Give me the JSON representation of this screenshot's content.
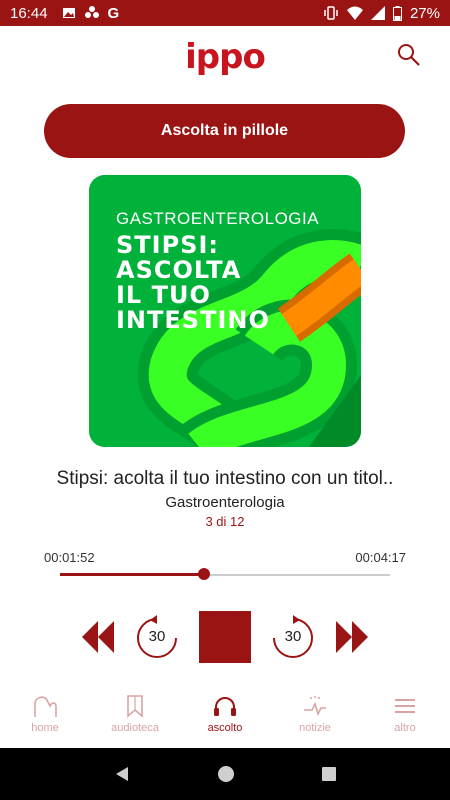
{
  "status_bar": {
    "time": "16:44",
    "battery": "27%"
  },
  "header": {
    "logo_text": "ippo"
  },
  "pill_button": {
    "label": "Ascolta in pillole"
  },
  "cover": {
    "category": "GASTROENTEROLOGIA",
    "title_lines": [
      "STIPSI:",
      "ASCOLTA",
      "IL TUO",
      "INTESTINO"
    ]
  },
  "track": {
    "title": "Stipsi: acolta il tuo intestino con un titol..",
    "category": "Gastroenterologia",
    "position": "3 di 12"
  },
  "player": {
    "elapsed": "00:01:52",
    "total": "00:04:17",
    "progress_fraction": 0.436,
    "rewind_seconds": "30",
    "forward_seconds": "30"
  },
  "nav": {
    "items": [
      {
        "label": "home",
        "icon": "home-icon"
      },
      {
        "label": "audioteca",
        "icon": "bookmark-icon"
      },
      {
        "label": "ascolto",
        "icon": "headphones-icon",
        "active": true
      },
      {
        "label": "notizie",
        "icon": "news-icon"
      },
      {
        "label": "altro",
        "icon": "menu-icon"
      }
    ]
  },
  "colors": {
    "brand": "#9b1414",
    "cover_green": "#00b23a",
    "cover_orange": "#ff8c00"
  }
}
